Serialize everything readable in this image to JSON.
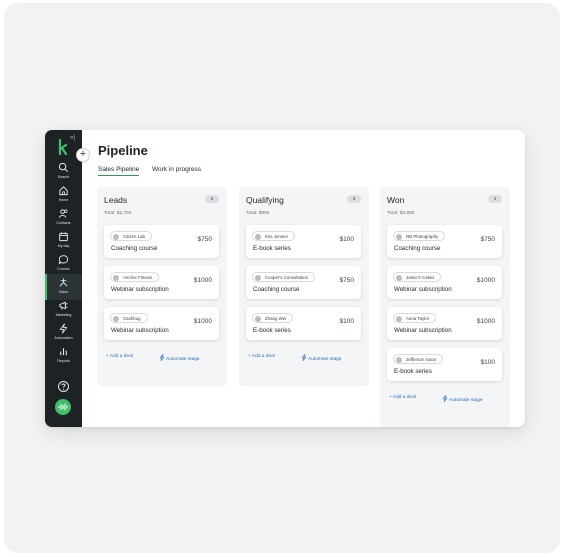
{
  "page": {
    "title": "Pipeline",
    "tabs": [
      {
        "label": "Sales Pipeline",
        "active": true
      },
      {
        "label": "Work in progress",
        "active": false
      }
    ]
  },
  "sidebar": {
    "collapse_glyph": "»|",
    "items": [
      {
        "label": "Search",
        "icon": "search-icon"
      },
      {
        "label": "Home",
        "icon": "home-icon"
      },
      {
        "label": "Contacts",
        "icon": "contacts-icon"
      },
      {
        "label": "My day",
        "icon": "calendar-icon"
      },
      {
        "label": "Comms",
        "icon": "chat-icon"
      },
      {
        "label": "Sales",
        "icon": "sales-icon",
        "active": true
      },
      {
        "label": "Marketing",
        "icon": "marketing-icon"
      },
      {
        "label": "Automation",
        "icon": "automation-icon"
      },
      {
        "label": "Reports",
        "icon": "reports-icon"
      }
    ]
  },
  "columns": [
    {
      "name": "Leads",
      "count": "3",
      "total": "Total: $2,750",
      "deals": [
        {
          "contact": "Citizen Lab",
          "name": "Coaching course",
          "value": "$750"
        },
        {
          "contact": "Anchor Fitness",
          "name": "Webinar subscription",
          "value": "$1000"
        },
        {
          "contact": "Cashbug",
          "name": "Webinar subscription",
          "value": "$1000"
        }
      ]
    },
    {
      "name": "Qualifying",
      "count": "3",
      "total": "Total: $950",
      "deals": [
        {
          "contact": "Kris Jensen",
          "name": "E-book series",
          "value": "$100"
        },
        {
          "contact": "Cooper's Consultation",
          "name": "Coaching course",
          "value": "$750"
        },
        {
          "contact": "Zhang Wei",
          "name": "E-book series",
          "value": "$100"
        }
      ]
    },
    {
      "name": "Won",
      "count": "4",
      "total": "Total: $2,850",
      "deals": [
        {
          "contact": "RB Photography",
          "name": "Coaching course",
          "value": "$750"
        },
        {
          "contact": "Jamie's Cakes",
          "name": "Webinar subscription",
          "value": "$1000"
        },
        {
          "contact": "Anna Taylor",
          "name": "Webinar subscription",
          "value": "$1000"
        },
        {
          "contact": "Jefferson Autos",
          "name": "E-book series",
          "value": "$100"
        }
      ]
    }
  ],
  "actions": {
    "add_deal": "+ Add a deal",
    "automate_stage": "Automate stage"
  },
  "colors": {
    "sidebar": "#1d2224",
    "accent_green": "#3fbf6a",
    "link_blue": "#2a6fbf"
  }
}
